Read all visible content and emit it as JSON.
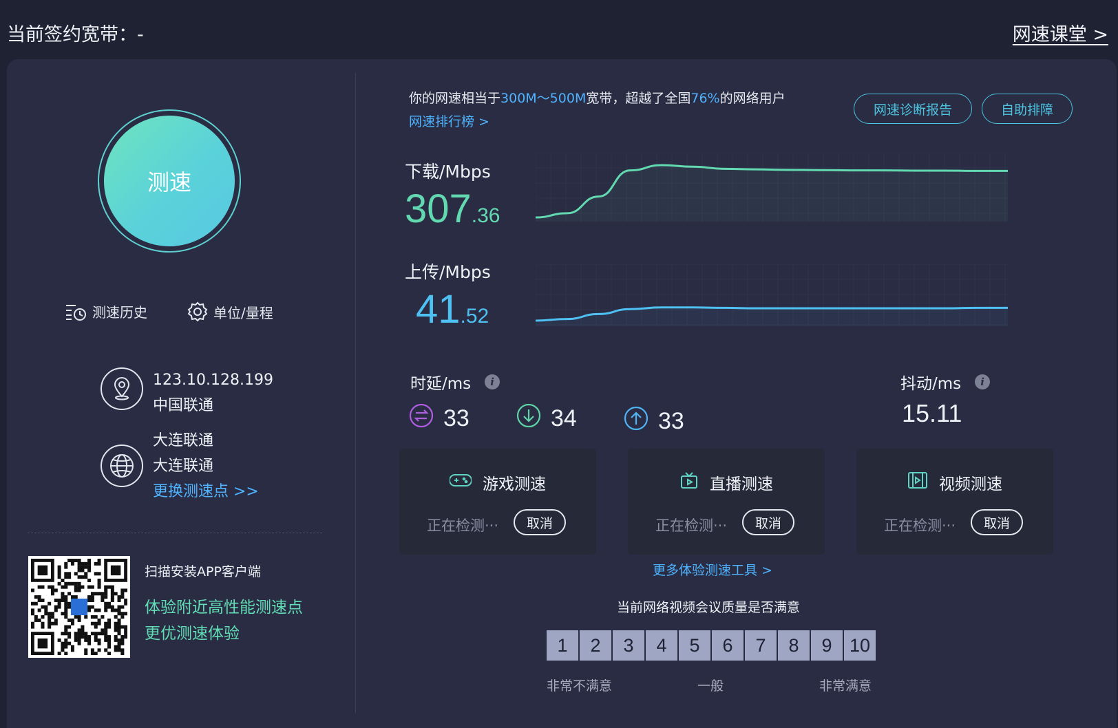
{
  "header": {
    "plan_title": "当前签约宽带：-",
    "classroom_link": "网速课堂 >"
  },
  "start": {
    "label": "测速"
  },
  "tools": {
    "history": "测速历史",
    "units": "单位/量程"
  },
  "client": {
    "ip": "123.10.128.199",
    "isp": "中国联通"
  },
  "server": {
    "node": "大连联通",
    "isp": "大连联通",
    "change_link": "更换测速点 >>"
  },
  "app_promo": {
    "scan": "扫描安装APP客户端",
    "line1": "体验附近高性能测速点",
    "line2": "更优测速体验"
  },
  "summary": {
    "prefix": "你的网速相当于",
    "range": "300M～500M",
    "mid": "宽带，超越了全国",
    "percent": "76%",
    "suffix": "的网络用户",
    "rank_link": "网速排行榜 >",
    "report_button": "网速诊断报告",
    "self_help_button": "自助排障"
  },
  "download": {
    "label": "下载/Mbps",
    "int": "307",
    "dec": ".36",
    "color": "#62d9b0"
  },
  "upload": {
    "label": "上传/Mbps",
    "int": "41",
    "dec": ".52",
    "color": "#4fc0f2"
  },
  "chart_data": [
    {
      "type": "line",
      "series": [
        {
          "values": [
            0,
            8,
            40,
            90,
            100,
            97,
            93,
            92,
            91,
            90.5,
            90,
            90,
            89.5,
            89.5,
            89,
            89
          ]
        }
      ]
    },
    {
      "type": "line",
      "series": [
        {
          "values": [
            0,
            2,
            8,
            14,
            16,
            16,
            15.5,
            15,
            15,
            15,
            15,
            15,
            15,
            15,
            15.5,
            15.5
          ]
        }
      ]
    }
  ],
  "latency": {
    "label": "时延/ms",
    "idle": "33",
    "down": "34",
    "up": "33"
  },
  "jitter": {
    "label": "抖动/ms",
    "value": "15.11"
  },
  "cards": [
    {
      "title": "游戏测速",
      "status": "正在检测···",
      "cancel": "取消"
    },
    {
      "title": "直播测速",
      "status": "正在检测···",
      "cancel": "取消"
    },
    {
      "title": "视频测速",
      "status": "正在检测···",
      "cancel": "取消"
    }
  ],
  "more_tools": "更多体验测速工具 >",
  "survey": {
    "question": "当前网络视频会议质量是否满意",
    "ratings": [
      "1",
      "2",
      "3",
      "4",
      "5",
      "6",
      "7",
      "8",
      "9",
      "10"
    ],
    "low": "非常不满意",
    "mid": "一般",
    "high": "非常满意"
  }
}
